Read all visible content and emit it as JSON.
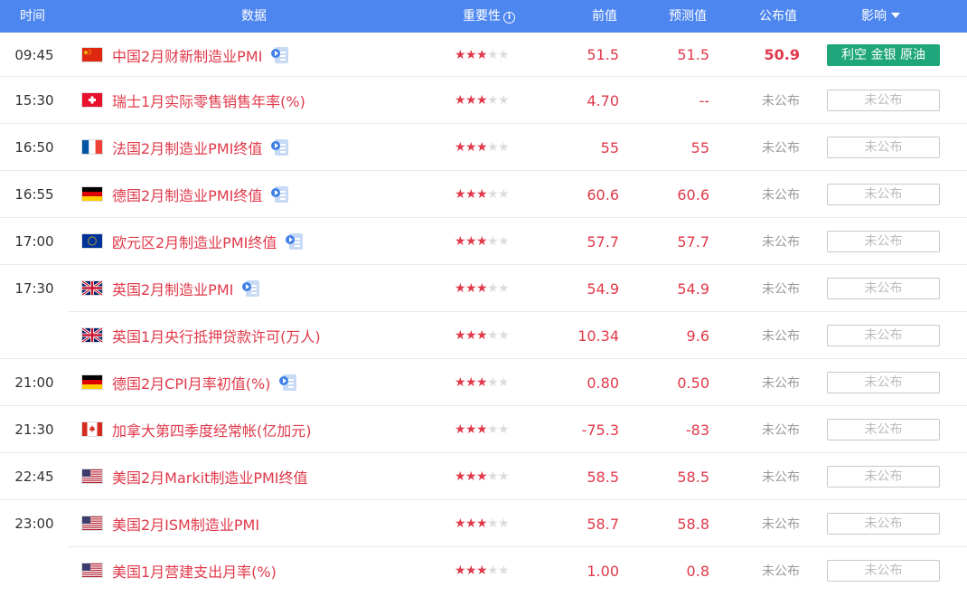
{
  "header": {
    "time": "时间",
    "data": "数据",
    "importance": "重要性",
    "info_icon": "i",
    "previous": "前值",
    "forecast": "预测值",
    "actual": "公布值",
    "impact": "影响"
  },
  "colors": {
    "header_bg": "#4d86ef",
    "red": "#e0394a",
    "impact_green": "#1fa67a"
  },
  "rows": [
    {
      "time": "09:45",
      "flag": "cn",
      "name": "中国2月财新制造业PMI",
      "video": true,
      "stars": 3,
      "previous": "51.5",
      "forecast": "51.5",
      "actual": "50.9",
      "impact": "利空 金银 原油"
    },
    {
      "time": "15:30",
      "flag": "ch",
      "name": "瑞士1月实际零售销售年率(%)",
      "video": false,
      "stars": 3,
      "previous": "4.70",
      "forecast": "--",
      "actual": "未公布",
      "impact": "未公布"
    },
    {
      "time": "16:50",
      "flag": "fr",
      "name": "法国2月制造业PMI终值",
      "video": true,
      "stars": 3,
      "previous": "55",
      "forecast": "55",
      "actual": "未公布",
      "impact": "未公布"
    },
    {
      "time": "16:55",
      "flag": "de",
      "name": "德国2月制造业PMI终值",
      "video": true,
      "stars": 3,
      "previous": "60.6",
      "forecast": "60.6",
      "actual": "未公布",
      "impact": "未公布"
    },
    {
      "time": "17:00",
      "flag": "eu",
      "name": "欧元区2月制造业PMI终值",
      "video": true,
      "stars": 3,
      "previous": "57.7",
      "forecast": "57.7",
      "actual": "未公布",
      "impact": "未公布"
    },
    {
      "time": "17:30",
      "flag": "gb",
      "name": "英国2月制造业PMI",
      "video": true,
      "stars": 3,
      "previous": "54.9",
      "forecast": "54.9",
      "actual": "未公布",
      "impact": "未公布"
    },
    {
      "time": "",
      "flag": "gb",
      "name": "英国1月央行抵押贷款许可(万人)",
      "video": false,
      "stars": 3,
      "previous": "10.34",
      "forecast": "9.6",
      "actual": "未公布",
      "impact": "未公布"
    },
    {
      "time": "21:00",
      "flag": "de",
      "name": "德国2月CPI月率初值(%)",
      "video": true,
      "stars": 3,
      "previous": "0.80",
      "forecast": "0.50",
      "actual": "未公布",
      "impact": "未公布"
    },
    {
      "time": "21:30",
      "flag": "ca",
      "name": "加拿大第四季度经常帐(亿加元)",
      "video": false,
      "stars": 3,
      "previous": "-75.3",
      "forecast": "-83",
      "actual": "未公布",
      "impact": "未公布"
    },
    {
      "time": "22:45",
      "flag": "us",
      "name": "美国2月Markit制造业PMI终值",
      "video": false,
      "stars": 3,
      "previous": "58.5",
      "forecast": "58.5",
      "actual": "未公布",
      "impact": "未公布"
    },
    {
      "time": "23:00",
      "flag": "us",
      "name": "美国2月ISM制造业PMI",
      "video": false,
      "stars": 3,
      "previous": "58.7",
      "forecast": "58.8",
      "actual": "未公布",
      "impact": "未公布"
    },
    {
      "time": "",
      "flag": "us",
      "name": "美国1月营建支出月率(%)",
      "video": false,
      "stars": 3,
      "previous": "1.00",
      "forecast": "0.8",
      "actual": "未公布",
      "impact": "未公布"
    }
  ]
}
